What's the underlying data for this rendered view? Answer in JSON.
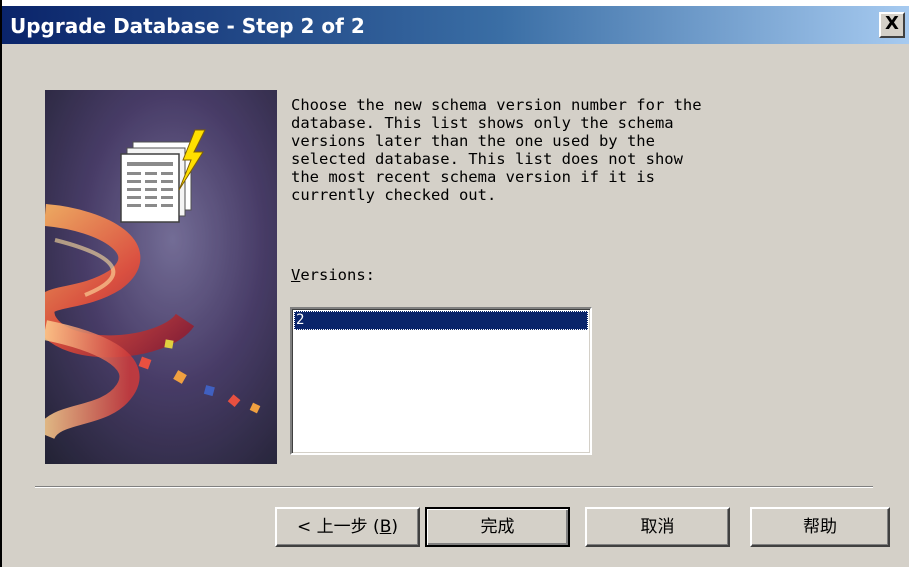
{
  "window": {
    "title": "Upgrade Database - Step 2 of 2",
    "close_label": "X"
  },
  "content": {
    "description": "Choose the new schema version number for the\ndatabase. This list shows only the schema\nversions later than the one used by the\nselected database. This list does not show\nthe most recent schema version if it is\ncurrently checked out.",
    "versions_label_accel": "V",
    "versions_label_rest": "ersions:",
    "versions": [
      "2"
    ],
    "selected_version": "2"
  },
  "buttons": {
    "back_prefix": "< 上一步 (",
    "back_accel": "B",
    "back_suffix": ")",
    "finish": "完成",
    "cancel": "取消",
    "help": "帮助"
  },
  "colors": {
    "selection": "#0a246a",
    "dialog_face": "#d4d0c8",
    "titlebar_start": "#0a246a",
    "titlebar_end": "#a6caf0"
  }
}
